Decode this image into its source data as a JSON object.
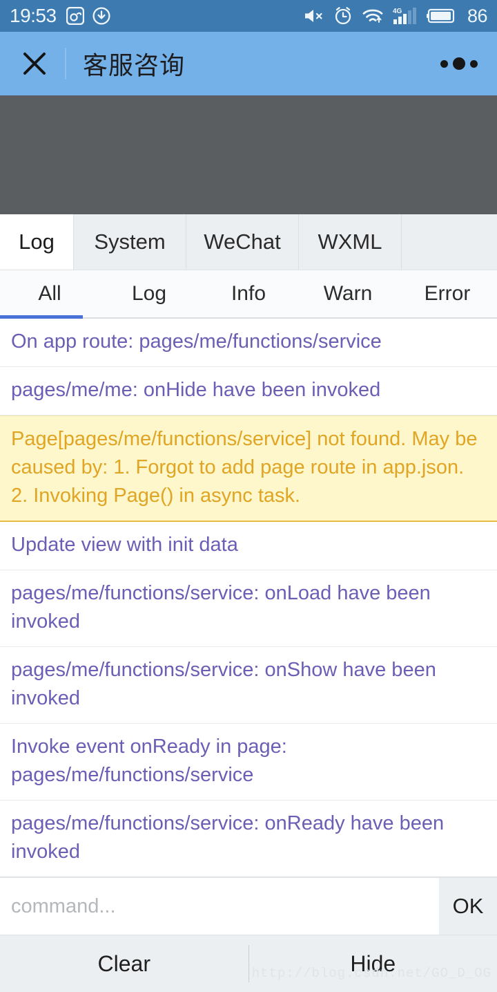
{
  "status_bar": {
    "time": "19:53",
    "battery_percent": "86",
    "network_type": "4G",
    "icons": [
      "weibo-icon",
      "download-circle-icon",
      "mute-icon",
      "alarm-icon",
      "wifi-icon",
      "signal-icon",
      "battery-icon"
    ],
    "background": "#3d7ab0"
  },
  "navbar": {
    "close_label": "close-icon",
    "title": "客服咨询",
    "more_label": "more-icon",
    "background": "#74b1e8"
  },
  "webview": {
    "background": "#5b5e61"
  },
  "console": {
    "tabs": [
      {
        "label": "Log",
        "active": true
      },
      {
        "label": "System",
        "active": false
      },
      {
        "label": "WeChat",
        "active": false
      },
      {
        "label": "WXML",
        "active": false
      }
    ],
    "filters": [
      {
        "label": "All",
        "active": true
      },
      {
        "label": "Log",
        "active": false
      },
      {
        "label": "Info",
        "active": false
      },
      {
        "label": "Warn",
        "active": false
      },
      {
        "label": "Error",
        "active": false
      }
    ],
    "active_filter_color": "#4a72d6",
    "log_text_color": "#6a5fb5",
    "warn_text_color": "#e0a524",
    "warn_background": "#fdf7cb",
    "entries": [
      {
        "level": "log",
        "text": "On app route: pages/me/functions/service"
      },
      {
        "level": "log",
        "text": "pages/me/me: onHide have been invoked"
      },
      {
        "level": "warn",
        "text": "Page[pages/me/functions/service] not found. May be caused by: 1. Forgot to add page route in app.json. 2. Invoking Page() in async task."
      },
      {
        "level": "log",
        "text": "Update view with init data"
      },
      {
        "level": "log",
        "text": "pages/me/functions/service: onLoad have been invoked"
      },
      {
        "level": "log",
        "text": "pages/me/functions/service: onShow have been invoked"
      },
      {
        "level": "log",
        "text": "Invoke event onReady in page: pages/me/functions/service"
      },
      {
        "level": "log",
        "text": "pages/me/functions/service: onReady have been invoked"
      }
    ]
  },
  "command_bar": {
    "value": "",
    "placeholder": "command...",
    "ok_label": "OK"
  },
  "action_bar": {
    "clear_label": "Clear",
    "hide_label": "Hide"
  },
  "watermark": {
    "text": "http://blog.csdn.net/GO_D_OG"
  }
}
